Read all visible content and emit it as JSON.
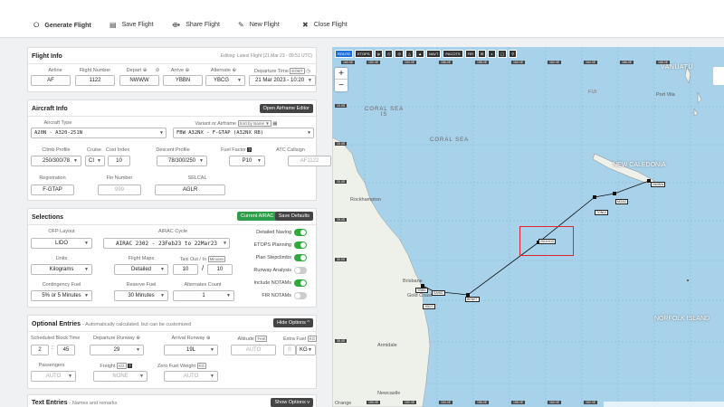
{
  "toolbar": {
    "generate": "Generate Flight",
    "save": "Save Flight",
    "share": "Share Flight",
    "new": "New Flight",
    "close": "Close Flight"
  },
  "flight_info": {
    "title": "Flight Info",
    "editing": "Editing: Latest Flight (21 Mar 23 - 09:51 UTC)",
    "labels": {
      "airline": "Airline",
      "flight_number": "Flight Number",
      "depart": "Depart ⊕",
      "arrive": "Arrive ⊕",
      "alternate": "Alternate ⊕",
      "departure_time": "Departure Time"
    },
    "departure_time_tag": "EOBT",
    "values": {
      "airline": "AF",
      "flight_number": "1122",
      "depart": "NWWW",
      "arrive": "YBBN",
      "alternate": "YBCG",
      "departure_time": "21 Mar 2023 - 10:20"
    }
  },
  "aircraft_info": {
    "title": "Aircraft Info",
    "open_editor": "Open Airframe Editor",
    "aircraft_type_label": "Aircraft Type",
    "aircraft_type": "A20N - A320-251N",
    "variant_label": "Variant or Airframe",
    "sort_by": "Sort by Name",
    "variant": "FBW A32NX - F-GTAP (A32NX RB)",
    "labels": {
      "climb": "Climb Profile",
      "cruise": "Cruise",
      "cost_index": "Cost Index",
      "descent": "Descent Profile",
      "fuel_factor": "Fuel Factor",
      "fuel_factor_tag": "?",
      "atc_callsign": "ATC Callsign"
    },
    "values": {
      "climb": "250/300/78",
      "cruise": "CI",
      "cost_index": "10",
      "descent": "78/300/250",
      "fuel_factor": "P10",
      "atc_callsign": "AF1122"
    },
    "labels2": {
      "registration": "Registration",
      "fin_number": "Fin Number",
      "selcal": "SELCAL"
    },
    "values2": {
      "registration": "F-GTAP",
      "fin_number": "999",
      "selcal": "AGLR"
    }
  },
  "selections": {
    "title": "Selections",
    "current_airac": "Current AIRAC",
    "save_defaults": "Save Defaults",
    "labels": {
      "ofp_layout": "OFP Layout",
      "airac_cycle": "AIRAC Cycle",
      "units": "Units",
      "flight_maps": "Flight Maps",
      "taxi": "Taxi Out / In",
      "taxi_tag": "Minutes",
      "contingency": "Contingency Fuel",
      "reserve": "Reserve Fuel",
      "alternates_count": "Alternates Count"
    },
    "values": {
      "ofp_layout": "LIDO",
      "airac_cycle": "AIRAC 2302 - 23Feb23 to 22Mar23",
      "units": "Kilograms",
      "flight_maps": "Detailed",
      "taxi_out": "10",
      "taxi_in": "10",
      "contingency": "5% or 5 Minutes",
      "reserve": "30 Minutes",
      "alternates_count": "1"
    },
    "toggles": [
      {
        "label": "Detailed Navlog",
        "on": true
      },
      {
        "label": "ETOPS Planning",
        "on": true
      },
      {
        "label": "Plan Stepclimbs",
        "on": true
      },
      {
        "label": "Runway Analysis",
        "on": false
      },
      {
        "label": "Include NOTAMs",
        "on": true
      },
      {
        "label": "FIR NOTAMs",
        "on": false
      }
    ]
  },
  "optional": {
    "title": "Optional Entries",
    "subtitle": "- Automatically calculated, but can be customized",
    "hide": "Hide Options ^",
    "labels": {
      "block_time": "Scheduled Block Time",
      "dep_rwy": "Departure Runway ⊕",
      "arr_rwy": "Arrival Runway ⊕",
      "altitude": "Altitude",
      "altitude_tag": "Feet",
      "extra_fuel": "Extra Fuel",
      "extra_fuel_tag": "KG",
      "passengers": "Passengers",
      "freight": "Freight",
      "freight_tag": "KG",
      "freight_tag2": "?",
      "zfw": "Zero Fuel Weight",
      "zfw_tag": "KG"
    },
    "values": {
      "block_h": "2",
      "block_m": "45",
      "dep_rwy": "29",
      "arr_rwy": "19L",
      "altitude": "AUTO",
      "extra_fuel": "0",
      "extra_unit": "KG",
      "passengers": "AUTO",
      "freight": "NONE",
      "zfw": "AUTO"
    }
  },
  "text_entries": {
    "title": "Text Entries",
    "subtitle": "- Names and remarks",
    "show": "Show Options v"
  },
  "map": {
    "toolbar": [
      "ROUTE",
      "ETOPS",
      "ꝕ",
      "◷",
      "◎",
      "△",
      "▲",
      "NAVT",
      "PACOTS",
      "FIR",
      "✉",
      "◐",
      "◯",
      "⚲"
    ],
    "zoom_in": "+",
    "zoom_out": "−",
    "top_coords": [
      "160.0E",
      "152.0E",
      "154.0E",
      "156.0E",
      "158.0E",
      "160.0E",
      "162.0E",
      "164.0E",
      "166.0E",
      "168.0E"
    ],
    "left_coords": [
      "10.0S",
      "15.0S",
      "20.0S",
      "25.0S",
      "30.0S",
      "35.0S"
    ],
    "bottom_coords": [
      "150.0E",
      "152.0E",
      "154.0E",
      "156.0E",
      "158.0E",
      "160.0E",
      "162.0E"
    ],
    "places": {
      "vanuatu": "VANUATU",
      "fiji": "FIJI",
      "port_vila": "Port Vila",
      "coral_sea_is": "CORAL SEA\nIS",
      "coral_sea": "CORAL SEA",
      "new_caledonia": "NEW CALEDONIA",
      "rockhampton": "Rockhampton",
      "brisbane": "Brisbane",
      "gold_coast": "Gold Coast",
      "armidale": "Armidale",
      "norfolk_island": "NORFOLK ISLAND",
      "newcastle": "Newcastle",
      "orange": "Orange"
    },
    "waypoints": {
      "nwww": "NWWW",
      "noao": "NOAO",
      "tonui": "TONUI",
      "highlighted": "2511HOX",
      "benet": "BENET",
      "ybbn": "YBBN",
      "sahid": "SAHID",
      "ybcg": "YBCG"
    }
  },
  "colors": {
    "accent_green": "#2e9e4a",
    "route_highlight": "#e0262a",
    "sea": "#a8d2ea",
    "land": "#eef0ea"
  }
}
